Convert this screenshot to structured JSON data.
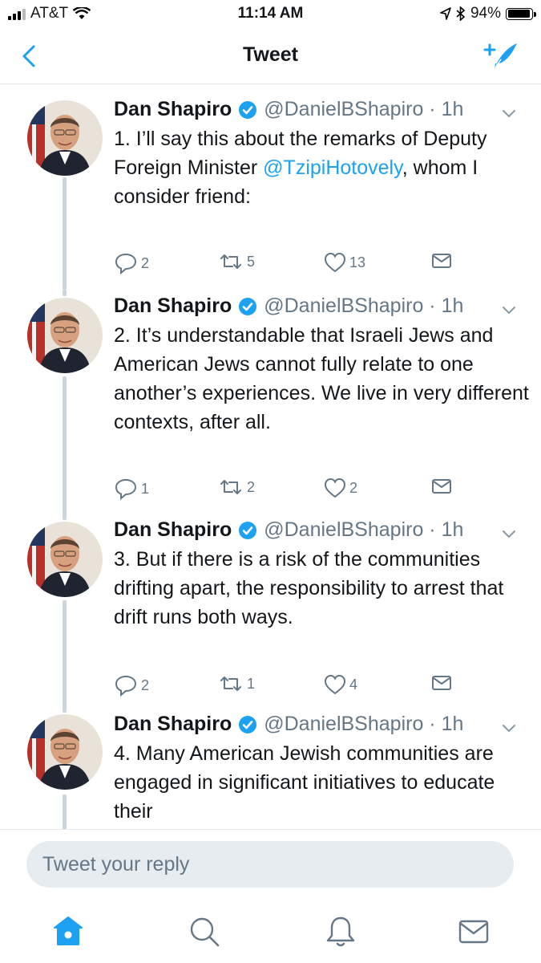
{
  "status_bar": {
    "carrier": "AT&T",
    "time": "11:14 AM",
    "battery_percent": "94%",
    "battery_level": 0.94
  },
  "nav": {
    "title": "Tweet"
  },
  "tweets": [
    {
      "name": "Dan Shapiro",
      "handle": "@DanielBShapiro",
      "time": "1h",
      "text_before": "1. I’ll say this about the remarks of Deputy Foreign Minister ",
      "mention": "@TzipiHotovely",
      "text_after": ", whom I consider friend:",
      "replies": "2",
      "retweets": "5",
      "likes": "13"
    },
    {
      "name": "Dan Shapiro",
      "handle": "@DanielBShapiro",
      "time": "1h",
      "text": "2. It’s understandable that Israeli Jews and American Jews cannot fully relate to one another’s experiences. We live in very different contexts, after all.",
      "replies": "1",
      "retweets": "2",
      "likes": "2"
    },
    {
      "name": "Dan Shapiro",
      "handle": "@DanielBShapiro",
      "time": "1h",
      "text": "3. But if there is a risk of the communities drifting apart, the responsibility to arrest that drift runs both ways.",
      "replies": "2",
      "retweets": "1",
      "likes": "4"
    },
    {
      "name": "Dan Shapiro",
      "handle": "@DanielBShapiro",
      "time": "1h",
      "text": "4. Many American Jewish communities are engaged in significant initiatives to educate their"
    }
  ],
  "reply": {
    "placeholder": "Tweet your reply"
  },
  "colors": {
    "accent": "#1da1f2",
    "muted": "#657786",
    "text": "#14171a",
    "thread_line": "#ccd6dd",
    "input_bg": "#e6ecf0"
  },
  "icons": [
    "back-chevron-icon",
    "compose-tweet-icon",
    "verified-badge-icon",
    "reply-icon",
    "retweet-icon",
    "like-icon",
    "direct-message-icon",
    "home-icon",
    "search-icon",
    "notifications-icon",
    "messages-icon"
  ]
}
